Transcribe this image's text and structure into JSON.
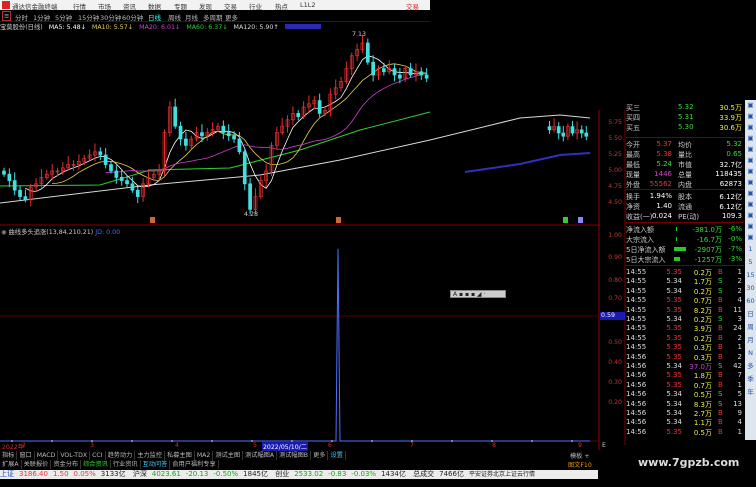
{
  "menubar": {
    "app": "通达信金融终端",
    "items": [
      "行情",
      "市场",
      "资讯",
      "数据",
      "专题",
      "发现",
      "交易",
      "行业",
      "热点",
      "L1L2"
    ],
    "trade": "交易"
  },
  "periods": [
    "分时",
    "1分钟",
    "5分钟",
    "15分钟",
    "30分钟",
    "60分钟",
    "日线",
    "周线",
    "月线",
    "多周期",
    "更多"
  ],
  "active_period": "日线",
  "ma_legend": {
    "stock": "宝莫股份(日线)",
    "ma5": "MA5: 5.48↓",
    "ma10": "MA10: 5.57↓",
    "ma20": "MA20: 6.01↓",
    "ma60": "MA60: 6.37↓",
    "ma120": "MA120: 5.90↑"
  },
  "colors": {
    "ma5": "#ffffff",
    "ma10": "#e8d050",
    "ma20": "#d040d0",
    "ma60": "#30d030",
    "ma120": "#d8d8d8",
    "ma250": "#3030c0",
    "up": "#e03030",
    "down": "#40e0e0"
  },
  "price_chart": {
    "high_mark": "7.13",
    "low_mark": "4.28",
    "axis": [
      "5.75",
      "5.50",
      "5.25",
      "5.00",
      "4.75",
      "4.50"
    ],
    "closes": [
      4.95,
      4.85,
      4.7,
      4.6,
      4.55,
      4.75,
      4.8,
      4.9,
      4.95,
      5.0,
      5.0,
      5.05,
      5.1,
      5.1,
      5.15,
      5.2,
      5.25,
      5.3,
      5.25,
      5.1,
      5.0,
      4.9,
      4.85,
      4.8,
      4.7,
      4.6,
      4.8,
      4.9,
      4.95,
      5.0,
      5.6,
      6.0,
      5.7,
      5.5,
      5.4,
      5.5,
      5.6,
      5.55,
      5.6,
      5.65,
      5.7,
      5.6,
      5.55,
      5.5,
      5.3,
      4.8,
      4.4,
      4.6,
      4.85,
      5.0,
      5.4,
      5.6,
      5.7,
      5.8,
      5.9,
      5.85,
      6.0,
      6.05,
      6.1,
      5.9,
      5.95,
      6.2,
      6.3,
      6.4,
      6.6,
      6.8,
      6.9,
      7.0,
      6.7,
      6.5,
      6.6,
      6.55,
      6.6,
      6.5,
      6.45,
      6.6,
      6.5,
      6.55,
      6.5,
      6.45
    ]
  },
  "quote": {
    "book": [
      [
        "买三",
        "5.32",
        "30.5万"
      ],
      [
        "买四",
        "5.31",
        "33.9万"
      ],
      [
        "买五",
        "5.30",
        "30.6万"
      ]
    ],
    "stats": [
      [
        "今开",
        "5.37",
        "均价",
        "5.32"
      ],
      [
        "最高",
        "5.38",
        "量比",
        "0.65"
      ],
      [
        "最低",
        "5.24",
        "市值",
        "32.7亿"
      ],
      [
        "现量",
        "1446",
        "总量",
        "118435"
      ],
      [
        "外盘",
        "55562",
        "内盘",
        "62873"
      ]
    ],
    "fund": [
      [
        "换手",
        "1.94%",
        "股本",
        "6.12亿"
      ],
      [
        "净资",
        "1.40",
        "流通",
        "6.12亿"
      ],
      [
        "收益(一)",
        "0.024",
        "PE(动)",
        "109.3"
      ]
    ],
    "flow": [
      [
        "净流入额",
        "-381.0万",
        "-6%"
      ],
      [
        "大宗流入",
        "-16.7万",
        "-0%"
      ],
      [
        "5日净流入额",
        "-2907万",
        "-7%"
      ],
      [
        "5日大宗流入",
        "-1257万",
        "-3%"
      ]
    ]
  },
  "ticks": [
    [
      "14:55",
      "5.35",
      "0.2万",
      "B",
      "1"
    ],
    [
      "14:55",
      "5.34",
      "1.7万",
      "S",
      "2"
    ],
    [
      "14:55",
      "5.34",
      "0.2万",
      "S",
      "2"
    ],
    [
      "14:55",
      "5.35",
      "0.7万",
      "B",
      "4"
    ],
    [
      "14:55",
      "5.35",
      "8.2万",
      "B",
      "11"
    ],
    [
      "14:55",
      "5.34",
      "0.2万",
      "S",
      "3"
    ],
    [
      "14:55",
      "5.35",
      "3.9万",
      "B",
      "24"
    ],
    [
      "14:55",
      "5.35",
      "0.2万",
      "B",
      "2"
    ],
    [
      "14:55",
      "5.35",
      "0.3万",
      "B",
      "1"
    ],
    [
      "14:56",
      "5.35",
      "0.3万",
      "B",
      "2"
    ],
    [
      "14:56",
      "5.34",
      "37.0万",
      "S",
      "42"
    ],
    [
      "14:56",
      "5.35",
      "1.8万",
      "B",
      "7"
    ],
    [
      "14:56",
      "5.35",
      "0.7万",
      "B",
      "1"
    ],
    [
      "14:56",
      "5.34",
      "0.5万",
      "S",
      "5"
    ],
    [
      "14:56",
      "5.34",
      "8.3万",
      "S",
      "13"
    ],
    [
      "14:56",
      "5.34",
      "2.7万",
      "B",
      "9"
    ],
    [
      "14:56",
      "5.34",
      "1.1万",
      "B",
      "4"
    ],
    [
      "14:56",
      "5.35",
      "0.5万",
      "B",
      "1"
    ]
  ],
  "indicator": {
    "title": "曲线多头追涨(13,84,210,21)",
    "value_label": "JD: 0.00",
    "axis": [
      "1.00",
      "0.90",
      "0.80",
      "0.70",
      "0.50",
      "0.40",
      "0.30",
      "0.20"
    ],
    "cursor_value": "0.59",
    "spike_value": 0.92
  },
  "timeline": {
    "year": "2022年",
    "months": [
      "2",
      "3",
      "4",
      "5",
      "6",
      "7",
      "8",
      "9"
    ],
    "cursor_date": "2022/05/10/二",
    "end": "E"
  },
  "tabs1": [
    "指标",
    "窗口",
    "MACD",
    "VOL-TDX",
    "CCI",
    "趋势动力",
    "主力监控",
    "私募主图",
    "MA2",
    "测试主图",
    "测试幅图A",
    "测试幅图B",
    "更多",
    "设置"
  ],
  "tabs1_right": "模板 +",
  "tabs2": [
    "扩展A",
    "关联报价",
    "资金分布",
    "综合资讯",
    "行业资讯",
    "互动问答",
    "俞用户福利专享"
  ],
  "tabs2_right": "图文F10",
  "status": {
    "sh": "上证",
    "sh_v": "3186.40",
    "sh_c": "1.50",
    "sh_p": "0.05%",
    "sh_a": "3133亿",
    "hs": "沪深",
    "hs_v": "4023.61",
    "hs_c": "-20.13",
    "hs_p": "-0.50%",
    "hs_a": "1845亿",
    "cy": "创业",
    "cy_v": "2533.02",
    "cy_c": "-0.83",
    "cy_p": "-0.03%",
    "cy_a": "1434亿",
    "tot": "总成交",
    "tot_v": "7466亿",
    "src": "平安证券北京上证云行情"
  },
  "rtool": [
    "1",
    "5",
    "15",
    "30",
    "60",
    "日",
    "周",
    "月",
    "N",
    "多",
    "季",
    "年"
  ],
  "watermark": "www.7gpzb.com"
}
